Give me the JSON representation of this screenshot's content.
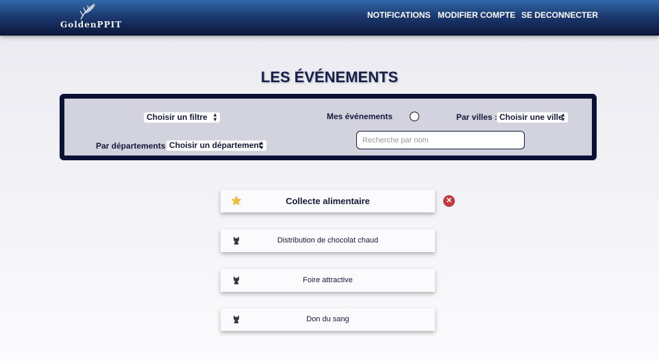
{
  "header": {
    "logo_text": "GoldenPPIT",
    "nav": [
      "NOTIFICATIONS",
      "MODIFIER COMPTE",
      "SE DECONNECTER"
    ]
  },
  "page_title": "LES ÉVÉNEMENTS",
  "filters": {
    "filter_select": "Choisir un filtre",
    "my_events_label": "Mes événements",
    "my_events_checked": false,
    "city_label": "Par villes :",
    "city_select": "Choisir une ville",
    "department_label": "Par départements :",
    "department_select": "Choisir un département",
    "search_placeholder": "Recherche par nom"
  },
  "events": [
    {
      "title": "Collecte alimentaire",
      "icon": "star-icon",
      "featured": true,
      "removable": true
    },
    {
      "title": "Distribution de chocolat chaud",
      "icon": "cat-icon",
      "featured": false,
      "removable": false
    },
    {
      "title": "Foire attractive",
      "icon": "cat-icon",
      "featured": false,
      "removable": false
    },
    {
      "title": "Don du sang",
      "icon": "cat-icon",
      "featured": false,
      "removable": false
    }
  ],
  "colors": {
    "header_top": "#2f69a6",
    "header_bottom": "#0b1638",
    "filter_border": "#0b1035",
    "filter_bg": "#d2d3df",
    "remove_red": "#c43a3a",
    "star_gold": "#f2c031"
  }
}
